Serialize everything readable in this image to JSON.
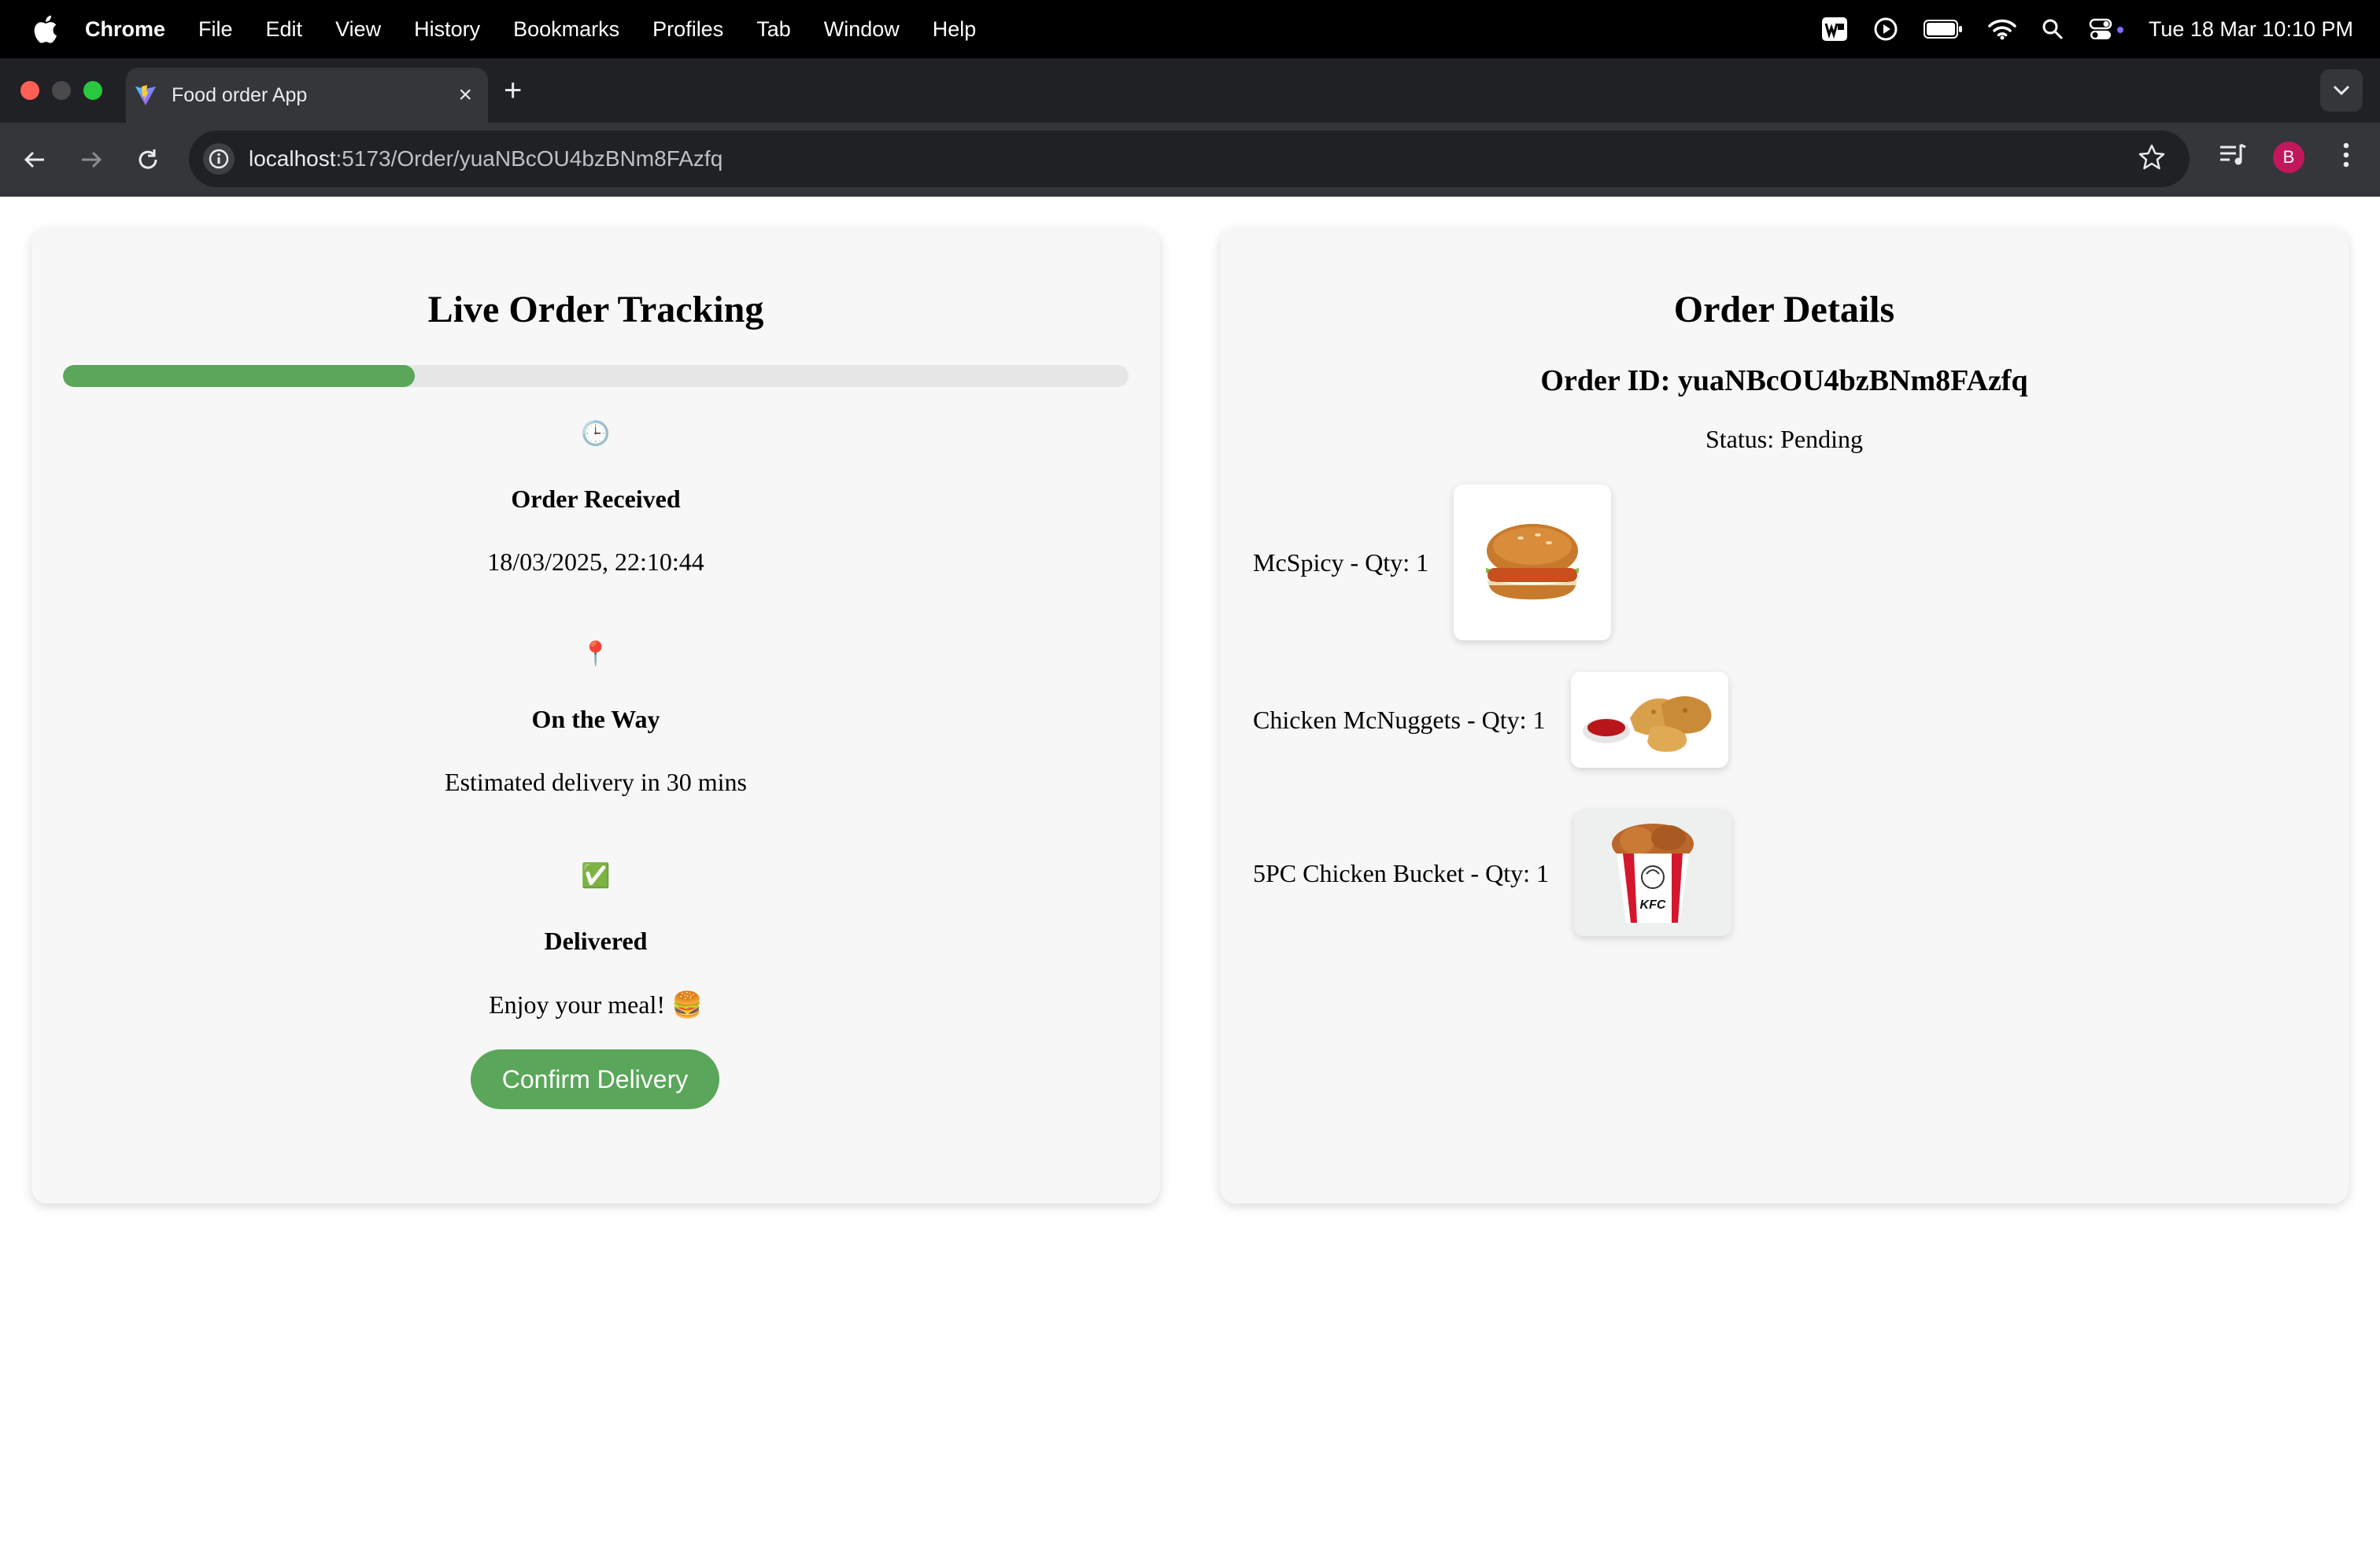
{
  "menubar": {
    "app_name": "Chrome",
    "items": [
      "File",
      "Edit",
      "View",
      "History",
      "Bookmarks",
      "Profiles",
      "Tab",
      "Window",
      "Help"
    ],
    "clock": "Tue 18 Mar  10:10 PM"
  },
  "browser": {
    "tab_title": "Food order App",
    "url_host": "localhost",
    "url_path": ":5173/Order/yuaNBcOU4bzBNm8FAzfq",
    "profile_initial": "B",
    "colors": {
      "tab_strip": "#202124",
      "toolbar": "#35363a",
      "profile": "#c2185b"
    }
  },
  "tracking": {
    "title": "Live Order Tracking",
    "progress": 0.33,
    "steps": [
      {
        "icon": "clock-icon",
        "glyph": "🕒",
        "title": "Order Received",
        "text": "18/03/2025, 22:10:44"
      },
      {
        "icon": "location-pin-icon",
        "glyph": "📍",
        "title": "On the Way",
        "text": "Estimated delivery in 30 mins"
      },
      {
        "icon": "check-mark-icon",
        "glyph": "✅",
        "title": "Delivered",
        "text": "Enjoy your meal! 🍔"
      }
    ],
    "confirm_label": "Confirm Delivery",
    "accent": "#5aa65a"
  },
  "order": {
    "title": "Order Details",
    "id_line": "Order ID: yuaNBcOU4bzBNm8FAzfq",
    "status_line": "Status: Pending",
    "items": [
      {
        "label": "McSpicy - Qty: 1",
        "image": "burger-image"
      },
      {
        "label": "Chicken McNuggets - Qty: 1",
        "image": "nuggets-image"
      },
      {
        "label": "5PC Chicken Bucket - Qty: 1",
        "image": "chicken-bucket-image"
      }
    ],
    "bucket_brand": "KFC"
  }
}
